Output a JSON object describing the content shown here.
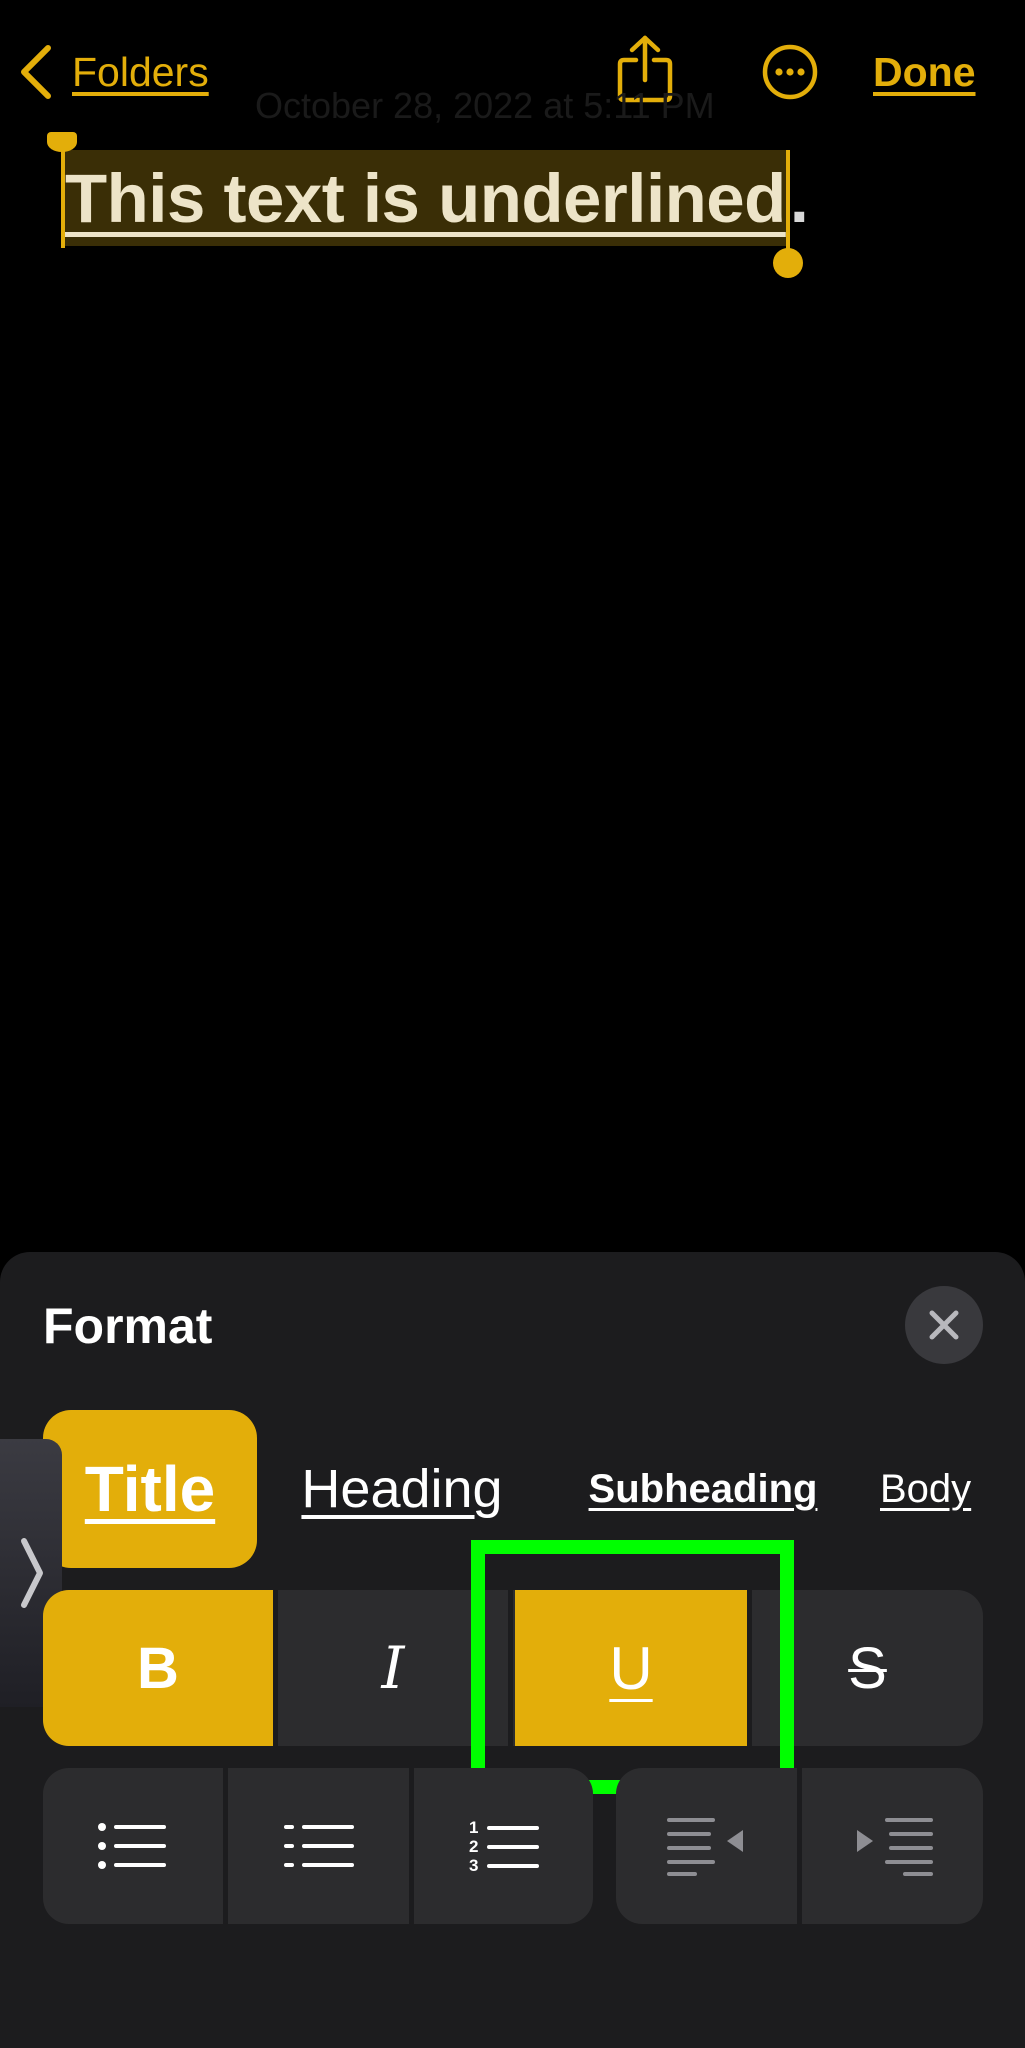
{
  "nav": {
    "back_label": "Folders",
    "done_label": "Done",
    "icons": {
      "back": "chevron-left-icon",
      "share": "share-icon",
      "more": "ellipsis-circle-icon"
    }
  },
  "note": {
    "date": "October 28, 2022 at 5:11 PM",
    "selected_text": "This text is underlined",
    "trailing_text": "."
  },
  "format_sheet": {
    "title": "Format",
    "close_icon": "close-icon",
    "styles": [
      {
        "label": "Title",
        "selected": true
      },
      {
        "label": "Heading",
        "selected": false
      },
      {
        "label": "Subheading",
        "selected": false
      },
      {
        "label": "Body",
        "selected": false
      }
    ],
    "text_styles": {
      "bold": {
        "label": "B",
        "active": true
      },
      "italic": {
        "label": "I",
        "active": false
      },
      "underline": {
        "label": "U",
        "active": true
      },
      "strikethrough": {
        "label": "S",
        "active": false
      }
    },
    "list_buttons": [
      "bulleted-list-icon",
      "dashed-list-icon",
      "numbered-list-icon",
      "outdent-icon",
      "indent-icon"
    ],
    "numbered_list_digits": [
      "1",
      "2",
      "3"
    ],
    "side_tab_icon": "chevron-right-icon"
  },
  "colors": {
    "accent": "#E3AE0A",
    "background": "#000000",
    "sheet": "#1C1C1E",
    "button": "#2C2C2E",
    "highlight_box": "#00FF00"
  }
}
